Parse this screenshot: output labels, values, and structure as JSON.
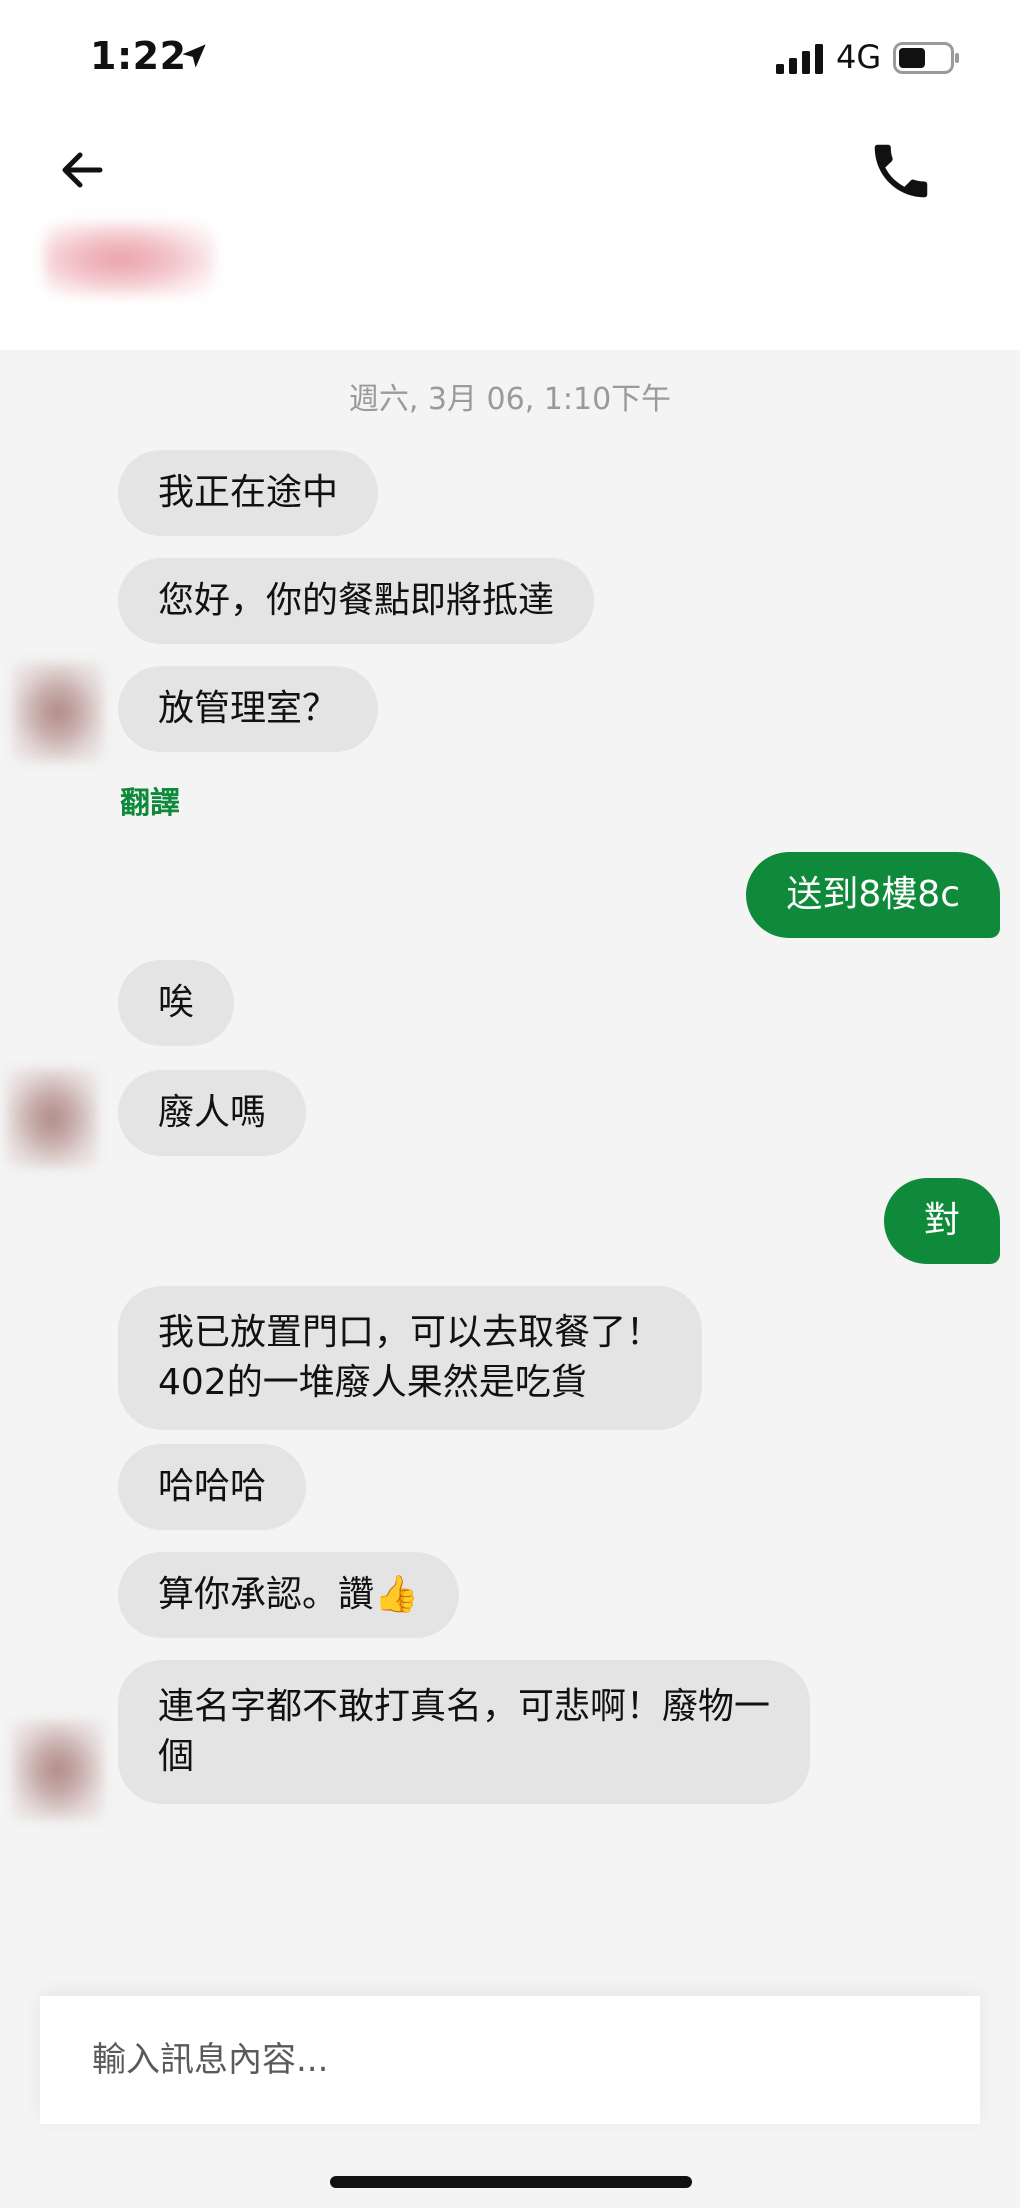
{
  "status_bar": {
    "time": "1:22",
    "network": "4G",
    "icons": [
      "location-arrow-icon",
      "signal-icon",
      "battery-icon"
    ]
  },
  "header": {
    "back_icon": "arrow-left-icon",
    "call_icon": "phone-icon"
  },
  "chat": {
    "timestamp": "週六, 3月 06, 1:10下午",
    "translate_label": "翻譯",
    "messages": [
      {
        "side": "in",
        "text": "我正在途中"
      },
      {
        "side": "in",
        "text": "您好，你的餐點即將抵達"
      },
      {
        "side": "in",
        "text": "放管理室？"
      },
      {
        "side": "out",
        "text": "送到8樓8c"
      },
      {
        "side": "in",
        "text": "唉"
      },
      {
        "side": "in",
        "text": "廢人嗎"
      },
      {
        "side": "out",
        "text": "對"
      },
      {
        "side": "in",
        "lines": [
          "我已放置門口，可以去取餐了！",
          "402的一堆廢人果然是吃貨"
        ]
      },
      {
        "side": "in",
        "text": "哈哈哈"
      },
      {
        "side": "in",
        "text": "算你承認。讚👍"
      },
      {
        "side": "in",
        "lines": [
          "連名字都不敢打真名，可悲啊！廢物一",
          "個"
        ]
      }
    ]
  },
  "composer": {
    "placeholder": "輸入訊息內容..."
  },
  "colors": {
    "accent": "#0f8a3b",
    "incoming_bubble": "#e4e4e4",
    "chat_background": "#f4f4f4"
  }
}
